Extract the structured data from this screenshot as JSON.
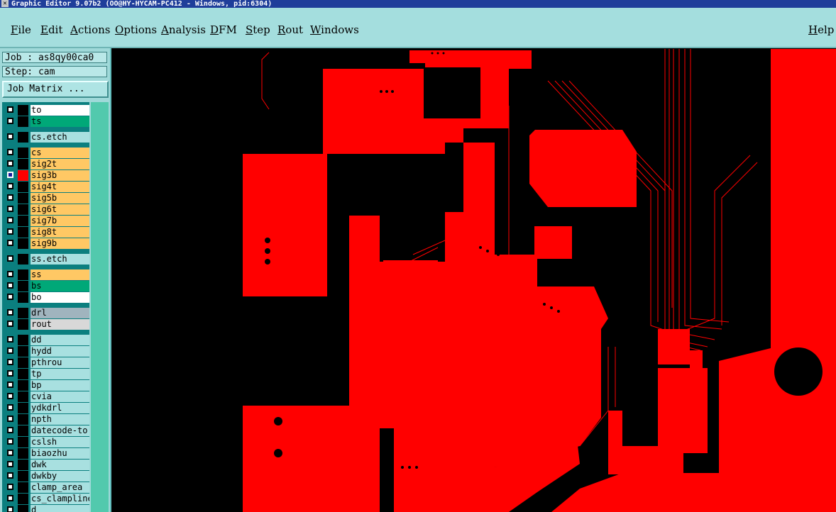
{
  "window": {
    "title": "Graphic Editor 9.07b2 (OO@HY-HYCAM-PC412 - Windows, pid:6304)"
  },
  "menubar": {
    "items": [
      "File",
      "Edit",
      "Actions",
      "Options",
      "Analysis",
      "DFM",
      "Step",
      "Rout",
      "Windows"
    ],
    "help": "Help"
  },
  "sidepanel": {
    "job": "Job : as8qy00ca0",
    "step": "Step: cam",
    "job_matrix_button": "Job Matrix ..."
  },
  "layers": [
    {
      "name": "to",
      "color": "#ffffff",
      "state": "normal"
    },
    {
      "name": "ts",
      "color": "#00a878",
      "state": "normal"
    },
    {
      "name": "cs.etch",
      "color": "#a8e0e0",
      "state": "normal"
    },
    {
      "name": "cs",
      "color": "#ffc864",
      "state": "normal"
    },
    {
      "name": "sig2t",
      "color": "#ffc864",
      "state": "normal"
    },
    {
      "name": "sig3b",
      "color": "#ffc864",
      "state": "active"
    },
    {
      "name": "sig4t",
      "color": "#ffc864",
      "state": "normal"
    },
    {
      "name": "sig5b",
      "color": "#ffc864",
      "state": "normal"
    },
    {
      "name": "sig6t",
      "color": "#ffc864",
      "state": "normal"
    },
    {
      "name": "sig7b",
      "color": "#ffc864",
      "state": "normal"
    },
    {
      "name": "sig8t",
      "color": "#ffc864",
      "state": "normal"
    },
    {
      "name": "sig9b",
      "color": "#ffc864",
      "state": "normal"
    },
    {
      "name": "ss.etch",
      "color": "#a8e0e0",
      "state": "normal"
    },
    {
      "name": "ss",
      "color": "#ffc864",
      "state": "normal"
    },
    {
      "name": "bs",
      "color": "#00a878",
      "state": "normal"
    },
    {
      "name": "bo",
      "color": "#ffffff",
      "state": "normal"
    },
    {
      "name": "drl",
      "color": "#a0b4be",
      "state": "normal"
    },
    {
      "name": "rout",
      "color": "#d8d8d8",
      "state": "normal"
    },
    {
      "name": "dd",
      "color": "#a8e0e0",
      "state": "normal"
    },
    {
      "name": "hydd",
      "color": "#a8e0e0",
      "state": "normal"
    },
    {
      "name": "pthrou",
      "color": "#a8e0e0",
      "state": "normal"
    },
    {
      "name": "tp",
      "color": "#a8e0e0",
      "state": "normal"
    },
    {
      "name": "bp",
      "color": "#a8e0e0",
      "state": "normal"
    },
    {
      "name": "cvia",
      "color": "#a8e0e0",
      "state": "normal"
    },
    {
      "name": "ydkdrl",
      "color": "#a8e0e0",
      "state": "normal"
    },
    {
      "name": "npth",
      "color": "#a8e0e0",
      "state": "normal"
    },
    {
      "name": "datecode-to",
      "color": "#a8e0e0",
      "state": "normal"
    },
    {
      "name": "cslsh",
      "color": "#a8e0e0",
      "state": "normal"
    },
    {
      "name": "biaozhu",
      "color": "#a8e0e0",
      "state": "normal"
    },
    {
      "name": "dwk",
      "color": "#a8e0e0",
      "state": "normal"
    },
    {
      "name": "dwkby",
      "color": "#a8e0e0",
      "state": "normal"
    },
    {
      "name": "clamp_area",
      "color": "#a8e0e0",
      "state": "normal"
    },
    {
      "name": "cs_clampline",
      "color": "#a8e0e0",
      "state": "normal"
    },
    {
      "name": "d",
      "color": "#a8e0e0",
      "state": "normal"
    }
  ],
  "workspace": {
    "layer_color": "#ff0000",
    "background_color": "#000000"
  }
}
